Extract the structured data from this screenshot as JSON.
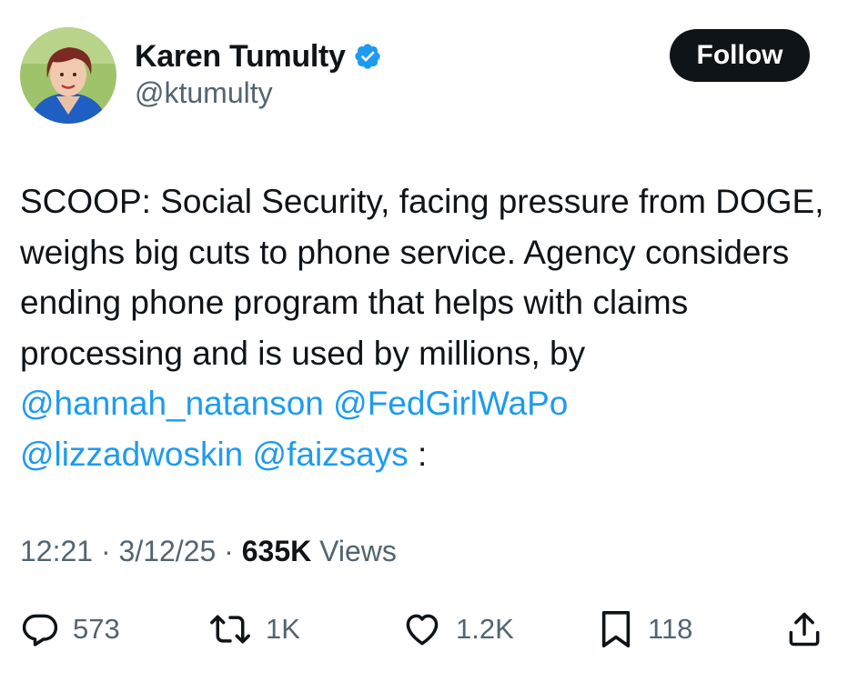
{
  "author": {
    "display_name": "Karen Tumulty",
    "handle": "@ktumulty",
    "verified": true
  },
  "follow_button": {
    "label": "Follow"
  },
  "tweet": {
    "text_plain": "SCOOP: Social Security, facing pressure from DOGE, weighs big cuts to phone service. Agency considers ending phone program that helps with claims processing and is used by millions, by ",
    "mentions": [
      "@hannah_natanson",
      "@FedGirlWaPo",
      "@lizzadwoskin",
      "@faizsays"
    ],
    "trailing": ":"
  },
  "meta": {
    "time": "12:21",
    "separator": "·",
    "date": "3/12/25",
    "views_count": "635K",
    "views_label": "Views"
  },
  "actions": {
    "replies": "573",
    "reposts": "1K",
    "likes": "1.2K",
    "bookmarks": "118"
  },
  "icons": {
    "verified": "verified-badge-icon",
    "reply": "reply-icon",
    "repost": "repost-icon",
    "like": "heart-icon",
    "bookmark": "bookmark-icon",
    "share": "share-icon"
  },
  "colors": {
    "text": "#0f1419",
    "secondary": "#536471",
    "link": "#1d9bf0",
    "follow_bg": "#0f1419",
    "verified": "#1d9bf0"
  }
}
